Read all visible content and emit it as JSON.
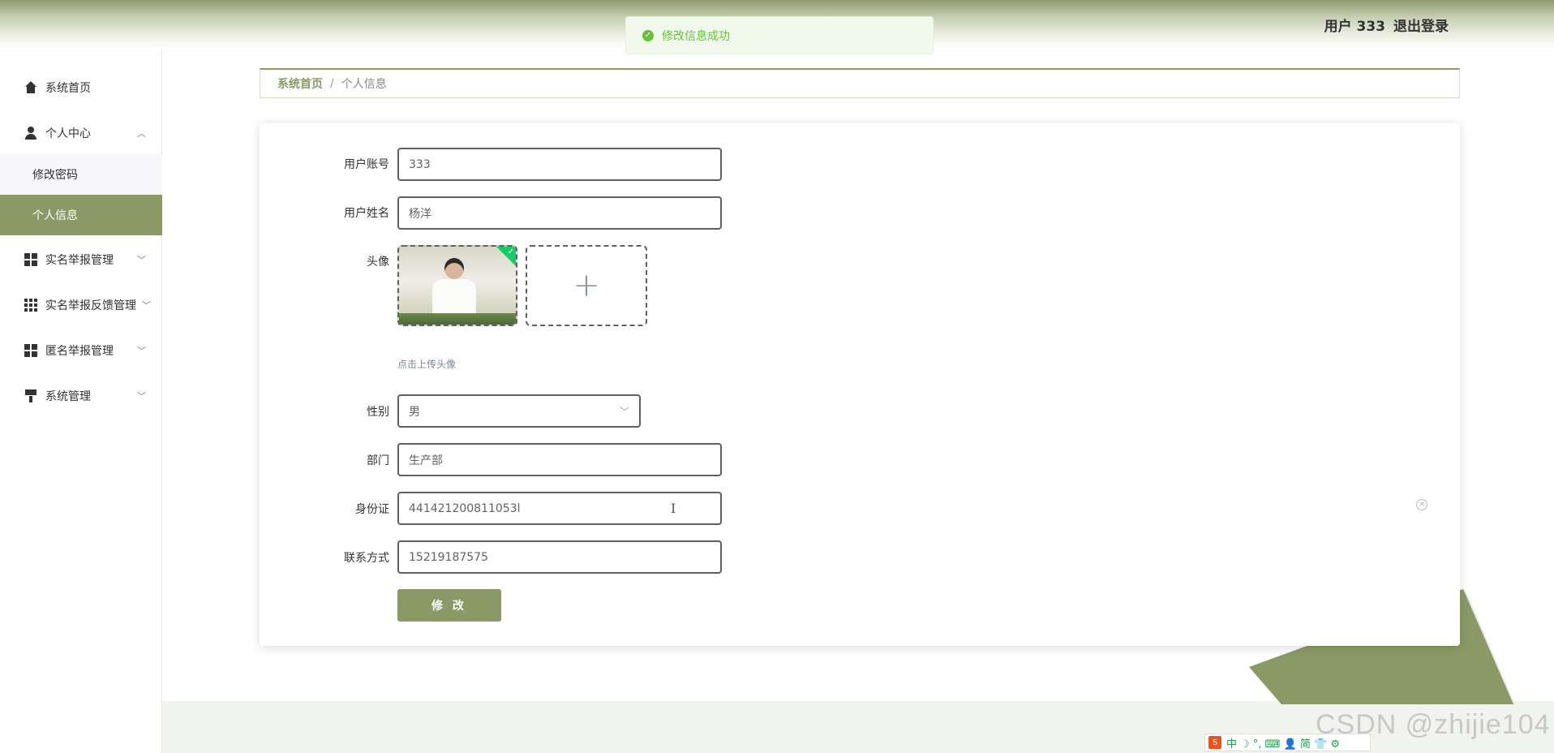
{
  "header": {
    "user_label": "用户 333",
    "logout_label": "退出登录"
  },
  "toast": {
    "message": "修改信息成功",
    "check_glyph": "✓"
  },
  "sidebar": {
    "items": [
      {
        "label": "系统首页",
        "icon": "home-icon"
      },
      {
        "label": "个人中心",
        "icon": "user-icon",
        "chevron": "︿"
      },
      {
        "label": "实名举报管理",
        "icon": "grid-icon",
        "chevron": "﹀"
      },
      {
        "label": "实名举报反馈管理",
        "icon": "apps-icon",
        "chevron": "﹀"
      },
      {
        "label": "匿名举报管理",
        "icon": "grid-icon",
        "chevron": "﹀"
      },
      {
        "label": "系统管理",
        "icon": "brush-icon",
        "chevron": "﹀"
      }
    ],
    "submenu": [
      {
        "label": "修改密码"
      },
      {
        "label": "个人信息"
      }
    ]
  },
  "breadcrumb": {
    "home": "系统首页",
    "separator": "/",
    "current": "个人信息"
  },
  "form": {
    "account_label": "用户账号",
    "account_value": "333",
    "name_label": "用户姓名",
    "name_value": "杨洋",
    "avatar_label": "头像",
    "upload_plus": "+",
    "upload_tip": "点击上传头像",
    "gender_label": "性别",
    "gender_value": "男",
    "gender_arrow": "﹀",
    "dept_label": "部门",
    "dept_value": "生产部",
    "idcard_label": "身份证",
    "idcard_value": "441421200811053l",
    "cursor_glyph": "I",
    "clear_glyph": "×",
    "phone_label": "联系方式",
    "phone_value": "15219187575",
    "submit_label": "修 改"
  },
  "ime": {
    "logo": "S",
    "chars": "中 ☽ °, ⌨ 👤 简 👕 ⚙"
  },
  "watermark": "CSDN @zhijie104",
  "colors": {
    "accent": "#8a9a66",
    "success": "#67c23a",
    "upload_ok": "#13ce66"
  }
}
